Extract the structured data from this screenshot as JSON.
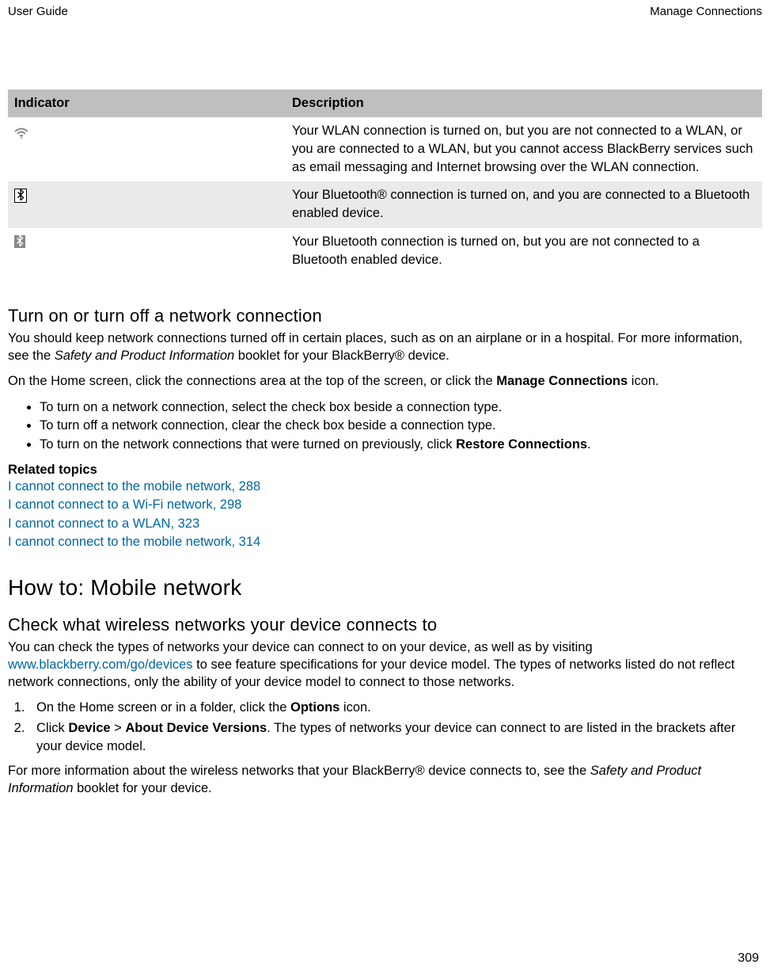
{
  "header": {
    "left": "User Guide",
    "right": "Manage Connections"
  },
  "table": {
    "col1": "Indicator",
    "col2": "Description",
    "rows": [
      {
        "icon_name": "wifi-dim-icon",
        "desc": "Your WLAN connection is turned on, but you are not connected to a WLAN, or you are connected to a WLAN, but you cannot access BlackBerry services such as email messaging and Internet browsing over the WLAN connection."
      },
      {
        "icon_name": "bluetooth-connected-icon",
        "desc": "Your Bluetooth® connection is turned on, and you are connected to a Bluetooth enabled device."
      },
      {
        "icon_name": "bluetooth-on-icon",
        "desc": "Your Bluetooth connection is turned on, but you are not connected to a Bluetooth enabled device."
      }
    ]
  },
  "section1": {
    "heading": "Turn on or turn off a network connection",
    "para1_a": "You should keep network connections turned off in certain places, such as on an airplane or in a hospital. For more information, see the ",
    "para1_italic": "Safety and Product Information",
    "para1_b": " booklet for your BlackBerry® device.",
    "para2_a": "On the Home screen, click the connections area at the top of the screen, or click the ",
    "para2_bold": "Manage Connections",
    "para2_b": " icon.",
    "bullet1": "To turn on a network connection, select the check box beside a connection type.",
    "bullet2": "To turn off a network connection, clear the check box beside a connection type.",
    "bullet3_a": "To turn on the network connections that were turned on previously, click ",
    "bullet3_bold": "Restore Connections",
    "bullet3_b": "."
  },
  "related": {
    "title": "Related topics",
    "links": [
      "I cannot connect to the mobile network, 288",
      "I cannot connect to a Wi-Fi network, 298",
      "I cannot connect to a WLAN, 323",
      "I cannot connect to the mobile network, 314"
    ]
  },
  "heading_big": "How to: Mobile network",
  "section2": {
    "heading": "Check what wireless networks your device connects to",
    "para1_a": "You can check the types of networks your device can connect to on your device, as well as by visiting ",
    "para1_link": "www.blackberry.com/go/devices",
    "para1_b": " to see feature specifications for your device model. The types of networks listed do not reflect network connections, only the ability of your device model to connect to those networks.",
    "step1_a": "On the Home screen or in a folder, click the ",
    "step1_bold": "Options",
    "step1_b": " icon.",
    "step2_a": "Click ",
    "step2_bold1": "Device",
    "step2_mid": " > ",
    "step2_bold2": "About Device Versions",
    "step2_b": ". The types of networks your device can connect to are listed in the brackets after your device model.",
    "para2_a": "For more information about the wireless networks that your BlackBerry® device connects to, see the ",
    "para2_italic": "Safety and Product Information",
    "para2_b": " booklet for your device."
  },
  "page_number": "309"
}
